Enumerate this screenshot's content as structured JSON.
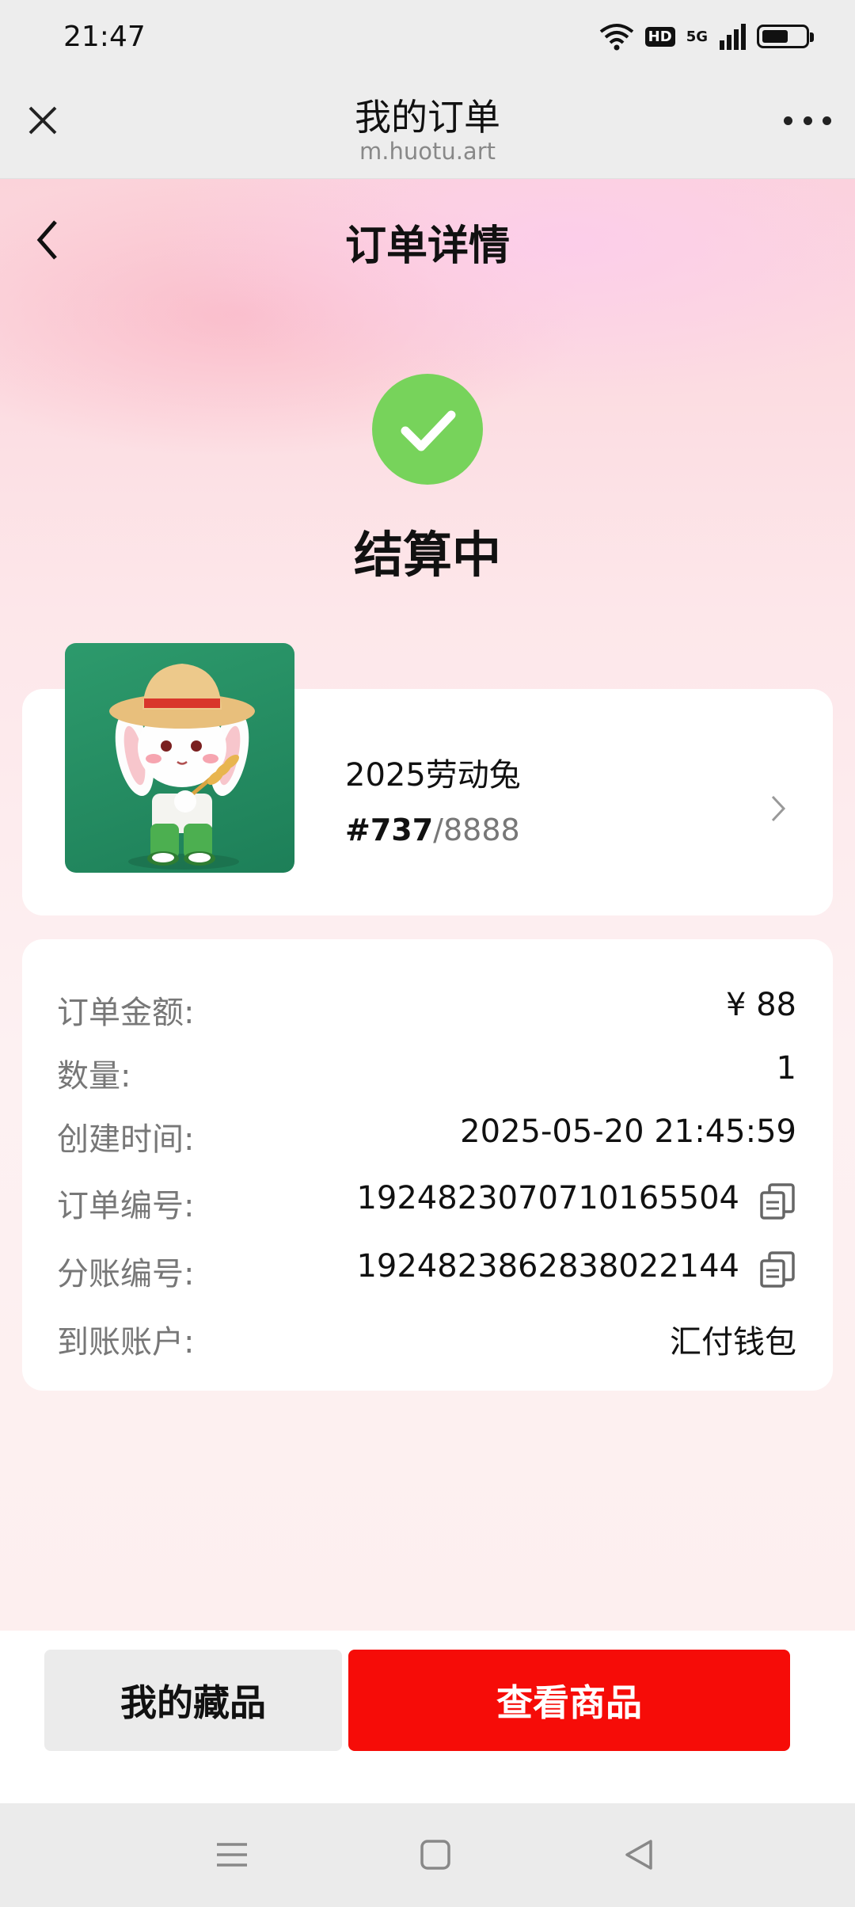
{
  "status_bar": {
    "time": "21:47",
    "hd": "HD",
    "network": "5G",
    "battery_level": 0.6
  },
  "browser": {
    "title": "我的订单",
    "url": "m.huotu.art"
  },
  "page": {
    "title": "订单详情",
    "status": "结算中"
  },
  "product": {
    "name": "2025劳动兔",
    "serial_current": "#737",
    "serial_separator": "/",
    "serial_total": "8888"
  },
  "order_info": {
    "rows": [
      {
        "label": "订单金额:",
        "value": "¥ 88"
      },
      {
        "label": "数量:",
        "value": "1"
      },
      {
        "label": "创建时间:",
        "value": "2025-05-20 21:45:59"
      },
      {
        "label": "订单编号:",
        "value": "1924823070710165504"
      },
      {
        "label": "分账编号:",
        "value": "1924823862838022144"
      },
      {
        "label": "到账账户:",
        "value": "汇付钱包"
      }
    ]
  },
  "actions": {
    "my_collection": "我的藏品",
    "view_product": "查看商品"
  },
  "colors": {
    "accent_red": "#f60c08",
    "success_green": "#77d35b"
  },
  "icons": [
    "wifi-icon",
    "signal-icon",
    "battery-icon",
    "close-icon",
    "more-icon",
    "back-icon",
    "check-icon",
    "chevron-right-icon",
    "copy-icon",
    "menu-icon",
    "home-icon",
    "back-triangle-icon"
  ]
}
